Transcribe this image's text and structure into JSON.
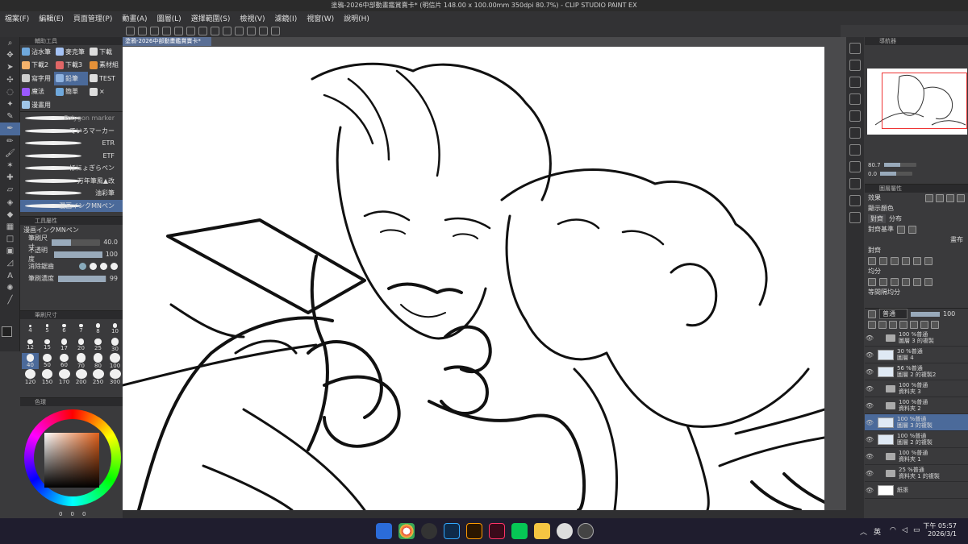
{
  "window_title": "塗鴉-2026中部動畫鑑賞賣卡* (明信片 148.00 x 100.00mm 350dpi 80.7%) - CLIP STUDIO PAINT EX",
  "menu": [
    "檔案(F)",
    "編輯(E)",
    "頁面管理(P)",
    "動畫(A)",
    "圖層(L)",
    "選擇範圍(S)",
    "檢視(V)",
    "濾鏡(I)",
    "視窗(W)",
    "說明(H)"
  ],
  "doc_tab": "塗鴉-2026中部動畫鑑賞賣卡*",
  "subtool": {
    "header": "輔助工具",
    "items": [
      "沾水筆",
      "麥克筆",
      "下載",
      "下載2",
      "下載3",
      "素材組",
      "寫字用",
      "鉛筆",
      "TEST",
      "魔法",
      "簡單",
      "×",
      "漫畫用"
    ],
    "selected": 7
  },
  "brushes": [
    "Polygon marker",
    "ていろマーカー",
    "ETR",
    "ETF",
    "ほにょぎらペン",
    "万年筆風▲改",
    "油彩筆",
    "漫画インクMNペン"
  ],
  "toolprop": {
    "header": "工具屬性",
    "brush_name": "漫画インクMNペン",
    "rows": [
      {
        "label": "筆刷尺寸",
        "value": "40.0",
        "fill": 0.4
      },
      {
        "label": "不透明度",
        "value": "100",
        "fill": 1
      },
      {
        "label": "消除鋸齒",
        "value": "",
        "fill": 0
      },
      {
        "label": "筆刷濃度",
        "value": "99",
        "fill": 0.99
      }
    ]
  },
  "brushsize": {
    "header": "筆刷尺寸",
    "sizes": [
      "4",
      "5",
      "6",
      "7",
      "8",
      "10",
      "12",
      "15",
      "17",
      "20",
      "25",
      "30",
      "40",
      "50",
      "60",
      "70",
      "80",
      "100",
      "120",
      "150",
      "170",
      "200",
      "250",
      "300"
    ],
    "selected": 12
  },
  "color": {
    "header": "色環",
    "fg": "#000000",
    "bg": "#ffffff",
    "accent": "#e0601a",
    "rgb": [
      "0",
      "0",
      "0"
    ]
  },
  "navigator": {
    "header": "導航器",
    "zoom": "80.7",
    "angle": "0.0"
  },
  "layer_prop": {
    "header": "圖層屬性",
    "effect": "效果",
    "display_color": "顯示顏色",
    "tabs": [
      "對齊",
      "分布"
    ],
    "align_base": "對齊基準",
    "canvas": "畫布",
    "align": "對齊",
    "distribute": "均分",
    "spacing": "等間隔均分"
  },
  "layers_header": {
    "blend": "普通",
    "opacity": "100"
  },
  "layers": [
    {
      "type": "folder",
      "pct": "100 %普通",
      "name": "圖層 3 的複製"
    },
    {
      "type": "layer",
      "pct": "30 %普通",
      "name": "圖層 4"
    },
    {
      "type": "layer",
      "pct": "56 %普通",
      "name": "圖層 2 的複製2"
    },
    {
      "type": "folder",
      "pct": "100 %普通",
      "name": "資料夾 3"
    },
    {
      "type": "folder",
      "pct": "100 %普通",
      "name": "資料夾 2"
    },
    {
      "type": "layer",
      "pct": "100 %普通",
      "name": "圖層 3 的複製",
      "selected": true
    },
    {
      "type": "layer",
      "pct": "100 %普通",
      "name": "圖層 2 的複製"
    },
    {
      "type": "folder",
      "pct": "100 %普通",
      "name": "資料夾 1"
    },
    {
      "type": "folder",
      "pct": "25 %普通",
      "name": "資料夾 1 的複製"
    },
    {
      "type": "paper",
      "pct": "",
      "name": "紙張"
    }
  ],
  "taskbar": {
    "lang": "英",
    "time": "下午 05:57",
    "date": "2026/3/1"
  }
}
